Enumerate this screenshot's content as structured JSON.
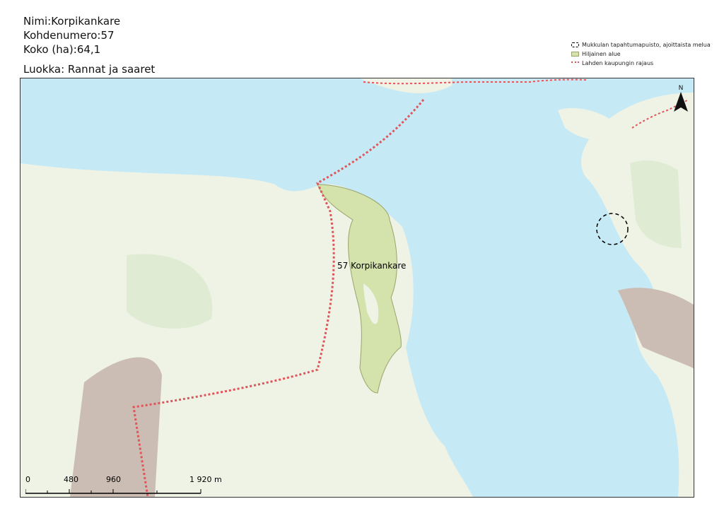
{
  "header": {
    "name_line": "Nimi:Korpikankare",
    "number_line": "Kohdenumero:57",
    "size_line": "Koko (ha):64,1",
    "class_line": "Luokka: Rannat ja saaret"
  },
  "legend": {
    "items": [
      {
        "label": "Mukkulan tapahtumapuisto, ajoittaista melua",
        "icon": "dashed-circle-icon"
      },
      {
        "label": "Hiljainen alue",
        "icon": "green-area-icon",
        "color": "#d4e2ab"
      },
      {
        "label": "Lahden kaupungin rajaus",
        "icon": "red-dotted-line-icon",
        "color": "#e0555a"
      }
    ]
  },
  "map": {
    "area_label": "57 Korpikankare",
    "colors": {
      "water": "#c6e9f6",
      "land": "#eef3e6",
      "forest": "#dfecd3",
      "quiet_area": "#d4e2ab",
      "urban": "#cbbdb3",
      "border": "#e0555a"
    }
  },
  "scalebar": {
    "ticks": [
      "0",
      "480",
      "960",
      "1 920 m"
    ]
  },
  "north_arrow": {
    "label": "N"
  }
}
